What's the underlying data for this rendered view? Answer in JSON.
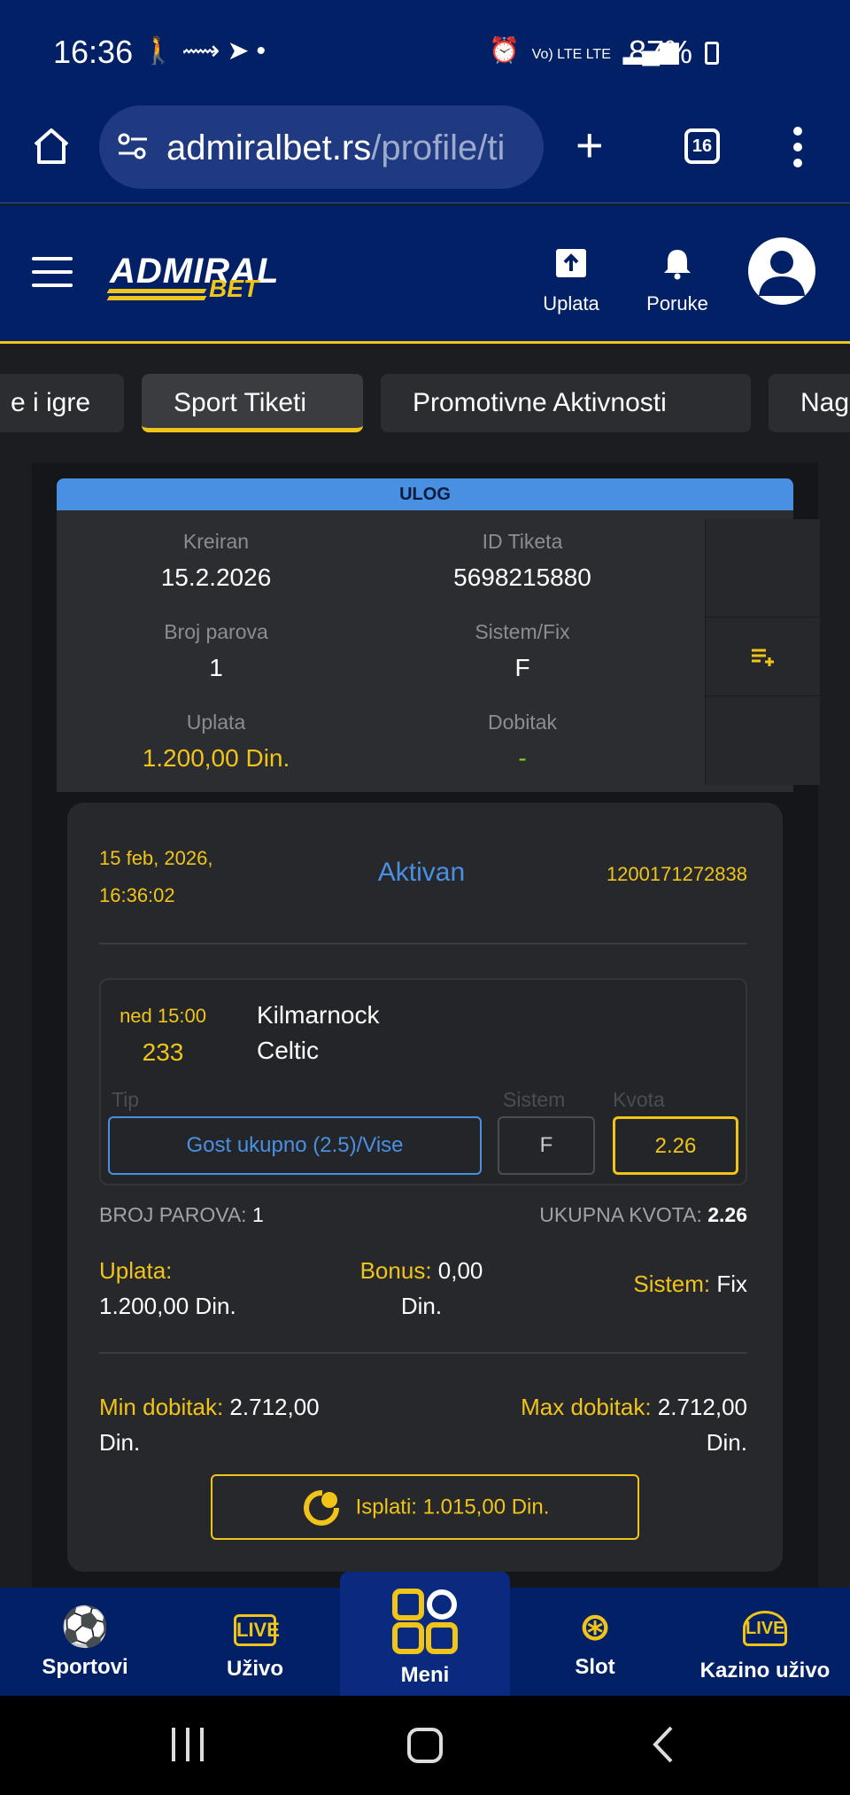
{
  "status_bar": {
    "time": "16:36",
    "left_icons": [
      "walk-icon",
      "cast-icon",
      "telegram-icon",
      "dot-icon"
    ],
    "network": "Vo) LTE LTE",
    "battery": "87%"
  },
  "browser": {
    "url_host": "admiralbet.rs",
    "url_path": "/profile/ti",
    "tab_count": "16"
  },
  "header": {
    "logo_top": "ADMIRAL",
    "logo_bottom": "BET",
    "deposit_label": "Uplata",
    "messages_label": "Poruke"
  },
  "tabs": [
    {
      "label": "e i igre",
      "active": false
    },
    {
      "label": "Sport Tiketi",
      "active": true
    },
    {
      "label": "Promotivne Aktivnosti",
      "active": false
    },
    {
      "label": "Nag",
      "active": false
    }
  ],
  "ticket": {
    "section_title": "ULOG",
    "created_label": "Kreiran",
    "created_value": "15.2.2026",
    "id_label": "ID Tiketa",
    "id_value": "5698215880",
    "pairs_label": "Broj parova",
    "pairs_value": "1",
    "system_label": "Sistem/Fix",
    "system_value": "F",
    "payin_label": "Uplata",
    "payin_value": "1.200,00 Din.",
    "win_label": "Dobitak",
    "win_value": "-"
  },
  "card": {
    "date": "15 feb, 2026,",
    "time": "16:36:02",
    "status": "Aktivan",
    "code": "1200171272838",
    "match": {
      "when": "ned 15:00",
      "number": "233",
      "home": "Kilmarnock",
      "away": "Celtic",
      "tip_label": "Tip",
      "sistem_label": "Sistem",
      "kvota_label": "Kvota",
      "tip_value": "Gost ukupno (2.5)/Vise",
      "sistem_value": "F",
      "kvota_value": "2.26"
    },
    "pairs_label": "BROJ PAROVA:",
    "pairs_value": "1",
    "total_odds_label": "UKUPNA KVOTA:",
    "total_odds_value": "2.26",
    "uplata_label": "Uplata:",
    "uplata_value": "1.200,00 Din.",
    "bonus_label": "Bonus:",
    "bonus_value": "0,00",
    "bonus_unit": "Din.",
    "sistem_label": "Sistem:",
    "sistem_value": "Fix",
    "min_label": "Min dobitak:",
    "min_value": "2.712,00",
    "min_unit": "Din.",
    "max_label": "Max dobitak:",
    "max_value": "2.712,00",
    "max_unit": "Din.",
    "cashout_label": "Isplati: 1.015,00 Din."
  },
  "bottom_nav": [
    {
      "label": "Sportovi",
      "icon": "sports-ball-icon"
    },
    {
      "label": "Uživo",
      "icon": "live-icon"
    },
    {
      "label": "Meni",
      "icon": "menu-grid-icon"
    },
    {
      "label": "Slot",
      "icon": "slot-chip-icon"
    },
    {
      "label": "Kazino uživo",
      "icon": "live-casino-icon"
    }
  ],
  "colors": {
    "brand_navy": "#022066",
    "accent_yellow": "#f0c419",
    "accent_blue": "#4a90e2",
    "panel_dark": "#1c1d20"
  }
}
